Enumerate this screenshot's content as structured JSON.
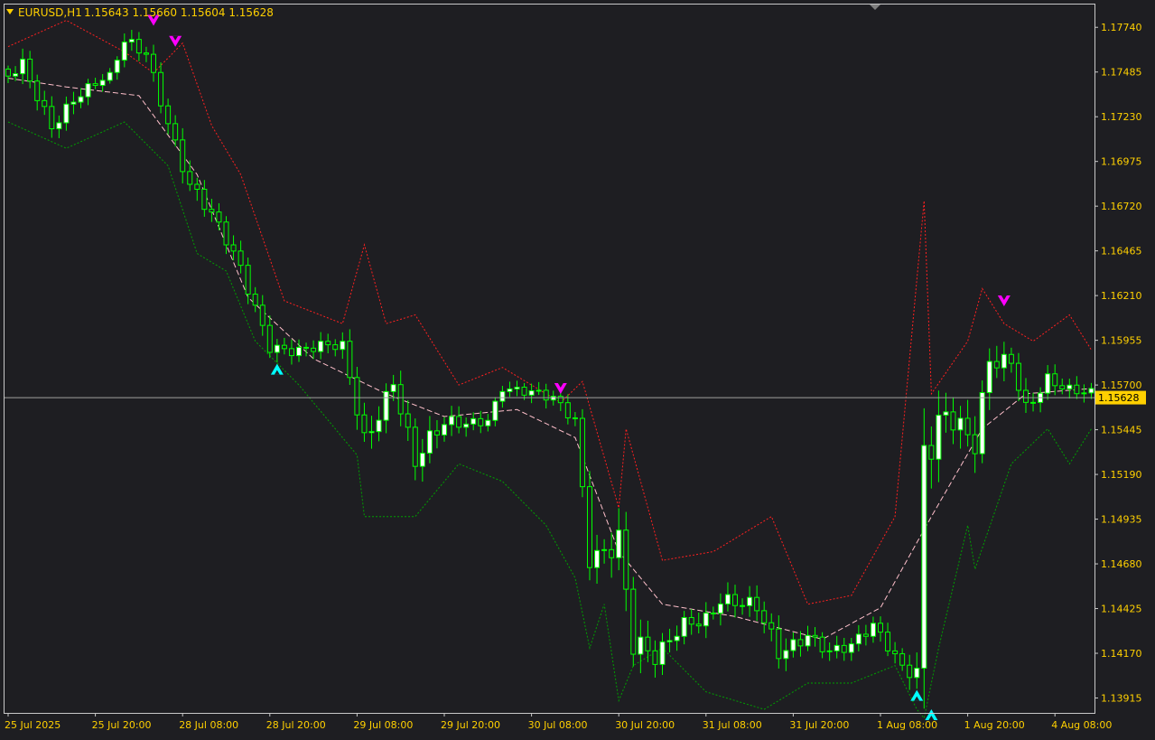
{
  "header": {
    "symbol": "EURUSD,H1",
    "ohlc": "1.15643 1.15660 1.15604 1.15628"
  },
  "colors": {
    "background": "#1e1e22",
    "frame": "#c8c8c8",
    "axis_text": "#ffd000",
    "bull_body": "#ffffff",
    "bear_body": "#1e1e22",
    "wick": "#00ff00",
    "mid_line": "#ffc0cb",
    "upper_band": "#ff2020",
    "lower_band": "#00a000",
    "arrow_sell": "#ff00ff",
    "arrow_buy": "#00ffff",
    "price_line": "#a0a0a0",
    "price_tag_bg": "#ffd000"
  },
  "icons": {
    "header_dropdown": "triangle-down-icon",
    "sell_signal": "arrow-down-icon",
    "buy_signal": "arrow-up-icon"
  },
  "chart_data": {
    "type": "candlestick",
    "timeframe": "H1",
    "ylim": [
      1.1383,
      1.1787
    ],
    "y_ticks": [
      "1.17740",
      "1.17485",
      "1.17230",
      "1.16975",
      "1.16720",
      "1.16465",
      "1.16210",
      "1.15955",
      "1.15700",
      "1.15445",
      "1.15190",
      "1.14935",
      "1.14680",
      "1.14425",
      "1.14170",
      "1.13915"
    ],
    "x_ticks": [
      "25 Jul 2025",
      "25 Jul 20:00",
      "28 Jul 08:00",
      "28 Jul 20:00",
      "29 Jul 08:00",
      "29 Jul 20:00",
      "30 Jul 08:00",
      "30 Jul 20:00",
      "31 Jul 08:00",
      "31 Jul 20:00",
      "1 Aug 08:00",
      "1 Aug 20:00",
      "4 Aug 08:00"
    ],
    "x_tick_bar_index": [
      0,
      12,
      24,
      36,
      48,
      60,
      72,
      84,
      96,
      108,
      120,
      132,
      144
    ],
    "current_price": "1.15628",
    "anchors": [
      {
        "bar": 0,
        "close": 1.1744,
        "range": 0.0008
      },
      {
        "bar": 2,
        "close": 1.1751,
        "range": 0.0012
      },
      {
        "bar": 6,
        "close": 1.172,
        "range": 0.0012
      },
      {
        "bar": 9,
        "close": 1.1735,
        "range": 0.0012
      },
      {
        "bar": 14,
        "close": 1.1745,
        "range": 0.0006
      },
      {
        "bar": 16,
        "close": 1.1764,
        "range": 0.0011
      },
      {
        "bar": 19,
        "close": 1.176,
        "range": 0.0011
      },
      {
        "bar": 25,
        "close": 1.1685,
        "range": 0.0014
      },
      {
        "bar": 28,
        "close": 1.1665,
        "range": 0.0012
      },
      {
        "bar": 32,
        "close": 1.1635,
        "range": 0.0012
      },
      {
        "bar": 36,
        "close": 1.1595,
        "range": 0.0012
      },
      {
        "bar": 40,
        "close": 1.159,
        "range": 0.001
      },
      {
        "bar": 46,
        "close": 1.159,
        "range": 0.0011
      },
      {
        "bar": 49,
        "close": 1.154,
        "range": 0.002
      },
      {
        "bar": 53,
        "close": 1.1575,
        "range": 0.0014
      },
      {
        "bar": 56,
        "close": 1.1525,
        "range": 0.002
      },
      {
        "bar": 60,
        "close": 1.1545,
        "range": 0.0014
      },
      {
        "bar": 66,
        "close": 1.1552,
        "range": 0.0008
      },
      {
        "bar": 68,
        "close": 1.157,
        "range": 0.0008
      },
      {
        "bar": 75,
        "close": 1.156,
        "range": 0.001
      },
      {
        "bar": 78,
        "close": 1.155,
        "range": 0.001
      },
      {
        "bar": 80,
        "close": 1.1475,
        "range": 0.0018
      },
      {
        "bar": 84,
        "close": 1.1485,
        "range": 0.0025
      },
      {
        "bar": 86,
        "close": 1.142,
        "range": 0.0025
      },
      {
        "bar": 89,
        "close": 1.141,
        "range": 0.0016
      },
      {
        "bar": 93,
        "close": 1.1435,
        "range": 0.0012
      },
      {
        "bar": 96,
        "close": 1.144,
        "range": 0.0014
      },
      {
        "bar": 98,
        "close": 1.145,
        "range": 0.0014
      },
      {
        "bar": 103,
        "close": 1.144,
        "range": 0.0014
      },
      {
        "bar": 106,
        "close": 1.1415,
        "range": 0.0016
      },
      {
        "bar": 110,
        "close": 1.143,
        "range": 0.0011
      },
      {
        "bar": 113,
        "close": 1.142,
        "range": 0.0011
      },
      {
        "bar": 116,
        "close": 1.142,
        "range": 0.0011
      },
      {
        "bar": 119,
        "close": 1.143,
        "range": 0.0011
      },
      {
        "bar": 123,
        "close": 1.141,
        "range": 0.0011
      },
      {
        "bar": 125,
        "close": 1.141,
        "range": 0.0018
      },
      {
        "bar": 126,
        "close": 1.1545,
        "range": 0.005
      },
      {
        "bar": 129,
        "close": 1.1555,
        "range": 0.0022
      },
      {
        "bar": 133,
        "close": 1.153,
        "range": 0.0022
      },
      {
        "bar": 135,
        "close": 1.158,
        "range": 0.002
      },
      {
        "bar": 138,
        "close": 1.1585,
        "range": 0.0014
      },
      {
        "bar": 140,
        "close": 1.156,
        "range": 0.0014
      },
      {
        "bar": 143,
        "close": 1.1575,
        "range": 0.0011
      },
      {
        "bar": 146,
        "close": 1.1565,
        "range": 0.0011
      },
      {
        "bar": 149,
        "close": 1.15628,
        "range": 0.001
      }
    ],
    "mid_line": [
      {
        "bar": 0,
        "price": 1.1745
      },
      {
        "bar": 8,
        "price": 1.174
      },
      {
        "bar": 18,
        "price": 1.1735
      },
      {
        "bar": 26,
        "price": 1.169
      },
      {
        "bar": 33,
        "price": 1.162
      },
      {
        "bar": 42,
        "price": 1.1585
      },
      {
        "bar": 52,
        "price": 1.1565
      },
      {
        "bar": 60,
        "price": 1.1552
      },
      {
        "bar": 70,
        "price": 1.1556
      },
      {
        "bar": 78,
        "price": 1.154
      },
      {
        "bar": 84,
        "price": 1.1475
      },
      {
        "bar": 90,
        "price": 1.1445
      },
      {
        "bar": 100,
        "price": 1.1438
      },
      {
        "bar": 112,
        "price": 1.1425
      },
      {
        "bar": 120,
        "price": 1.1443
      },
      {
        "bar": 127,
        "price": 1.1495
      },
      {
        "bar": 134,
        "price": 1.1545
      },
      {
        "bar": 140,
        "price": 1.1565
      },
      {
        "bar": 149,
        "price": 1.1568
      }
    ],
    "upper_band": [
      {
        "bar": 0,
        "price": 1.1763
      },
      {
        "bar": 8,
        "price": 1.1778
      },
      {
        "bar": 16,
        "price": 1.176
      },
      {
        "bar": 20,
        "price": 1.1748
      },
      {
        "bar": 24,
        "price": 1.1765
      },
      {
        "bar": 28,
        "price": 1.1718
      },
      {
        "bar": 32,
        "price": 1.169
      },
      {
        "bar": 38,
        "price": 1.1618
      },
      {
        "bar": 46,
        "price": 1.1605
      },
      {
        "bar": 49,
        "price": 1.165
      },
      {
        "bar": 52,
        "price": 1.1605
      },
      {
        "bar": 56,
        "price": 1.161
      },
      {
        "bar": 62,
        "price": 1.157
      },
      {
        "bar": 68,
        "price": 1.158
      },
      {
        "bar": 76,
        "price": 1.156
      },
      {
        "bar": 79,
        "price": 1.1572
      },
      {
        "bar": 84,
        "price": 1.15
      },
      {
        "bar": 85,
        "price": 1.1545
      },
      {
        "bar": 90,
        "price": 1.147
      },
      {
        "bar": 97,
        "price": 1.1475
      },
      {
        "bar": 105,
        "price": 1.1495
      },
      {
        "bar": 110,
        "price": 1.1445
      },
      {
        "bar": 116,
        "price": 1.145
      },
      {
        "bar": 122,
        "price": 1.1495
      },
      {
        "bar": 126,
        "price": 1.1675
      },
      {
        "bar": 127,
        "price": 1.1565
      },
      {
        "bar": 132,
        "price": 1.1595
      },
      {
        "bar": 134,
        "price": 1.1625
      },
      {
        "bar": 137,
        "price": 1.1605
      },
      {
        "bar": 141,
        "price": 1.1595
      },
      {
        "bar": 146,
        "price": 1.161
      },
      {
        "bar": 149,
        "price": 1.159
      }
    ],
    "lower_band": [
      {
        "bar": 0,
        "price": 1.172
      },
      {
        "bar": 8,
        "price": 1.1705
      },
      {
        "bar": 16,
        "price": 1.172
      },
      {
        "bar": 22,
        "price": 1.1695
      },
      {
        "bar": 26,
        "price": 1.1645
      },
      {
        "bar": 30,
        "price": 1.1635
      },
      {
        "bar": 34,
        "price": 1.1595
      },
      {
        "bar": 40,
        "price": 1.157
      },
      {
        "bar": 48,
        "price": 1.153
      },
      {
        "bar": 49,
        "price": 1.1495
      },
      {
        "bar": 56,
        "price": 1.1495
      },
      {
        "bar": 62,
        "price": 1.1525
      },
      {
        "bar": 68,
        "price": 1.1515
      },
      {
        "bar": 74,
        "price": 1.149
      },
      {
        "bar": 78,
        "price": 1.146
      },
      {
        "bar": 80,
        "price": 1.142
      },
      {
        "bar": 82,
        "price": 1.1445
      },
      {
        "bar": 84,
        "price": 1.139
      },
      {
        "bar": 86,
        "price": 1.141
      },
      {
        "bar": 90,
        "price": 1.142
      },
      {
        "bar": 96,
        "price": 1.1395
      },
      {
        "bar": 104,
        "price": 1.1385
      },
      {
        "bar": 110,
        "price": 1.14
      },
      {
        "bar": 116,
        "price": 1.14
      },
      {
        "bar": 122,
        "price": 1.141
      },
      {
        "bar": 125,
        "price": 1.1385
      },
      {
        "bar": 126,
        "price": 1.138
      },
      {
        "bar": 128,
        "price": 1.142
      },
      {
        "bar": 132,
        "price": 1.149
      },
      {
        "bar": 133,
        "price": 1.1465
      },
      {
        "bar": 138,
        "price": 1.1525
      },
      {
        "bar": 143,
        "price": 1.1545
      },
      {
        "bar": 146,
        "price": 1.1525
      },
      {
        "bar": 149,
        "price": 1.1545
      }
    ],
    "sell_arrows": [
      {
        "bar": 20,
        "price": 1.1778
      },
      {
        "bar": 23,
        "price": 1.1766
      },
      {
        "bar": 76,
        "price": 1.1568
      },
      {
        "bar": 137,
        "price": 1.1618
      }
    ],
    "buy_arrows": [
      {
        "bar": 37,
        "price": 1.1579
      },
      {
        "bar": 125,
        "price": 1.1393
      },
      {
        "bar": 127,
        "price": 1.1382
      }
    ]
  }
}
